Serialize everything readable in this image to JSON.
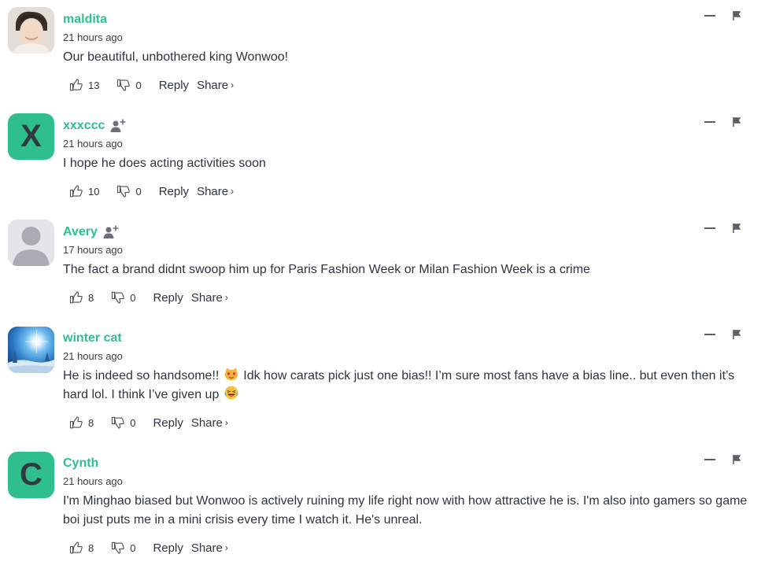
{
  "comments": [
    {
      "username": "maldita",
      "time": "21 hours ago",
      "text": "Our beautiful, unbothered king Wonwoo!",
      "likes": "13",
      "dislikes": "0",
      "reply_label": "Reply",
      "share_label": "Share",
      "avatar": "photo"
    },
    {
      "username": "xxxccc",
      "time": "21 hours ago",
      "text": "I hope he does acting activities soon",
      "likes": "10",
      "dislikes": "0",
      "reply_label": "Reply",
      "share_label": "Share",
      "avatar": "letter",
      "avatar_letter": "X"
    },
    {
      "username": "Avery",
      "time": "17 hours ago",
      "text": "The fact a brand didnt swoop him up for Paris Fashion Week or Milan Fashion Week is a crime",
      "likes": "8",
      "dislikes": "0",
      "reply_label": "Reply",
      "share_label": "Share",
      "avatar": "default"
    },
    {
      "username": "winter cat",
      "time": "21 hours ago",
      "text_part1": "He is indeed so handsome!!",
      "text_part2": "Idk how carats pick just one bias!! I’m sure most fans have a bias line.. but even then it’s hard lol. I think I’ve given up",
      "likes": "8",
      "dislikes": "0",
      "reply_label": "Reply",
      "share_label": "Share",
      "avatar": "sky"
    },
    {
      "username": "Cynth",
      "time": "21 hours ago",
      "text": "I'm Minghao biased but Wonwoo is actively ruining my life right now with how attractive he is. I'm also into gamers so game boi just puts me in a mini crisis every time I watch it. He's unreal.",
      "likes": "8",
      "dislikes": "0",
      "reply_label": "Reply",
      "share_label": "Share",
      "avatar": "letter",
      "avatar_letter": "C"
    }
  ],
  "icons": {
    "like": "thumbs-up-icon",
    "dislike": "thumbs-down-icon",
    "follow": "add-user-icon",
    "minimize": "minimize-icon",
    "flag": "flag-icon",
    "emoji_heart_eyes_cat": "heart-eyes-cat-emoji",
    "emoji_laughing": "laughing-emoji"
  },
  "colors": {
    "username": "#2fbf8f",
    "avatar_letter_bg": "#2fbf8f"
  }
}
